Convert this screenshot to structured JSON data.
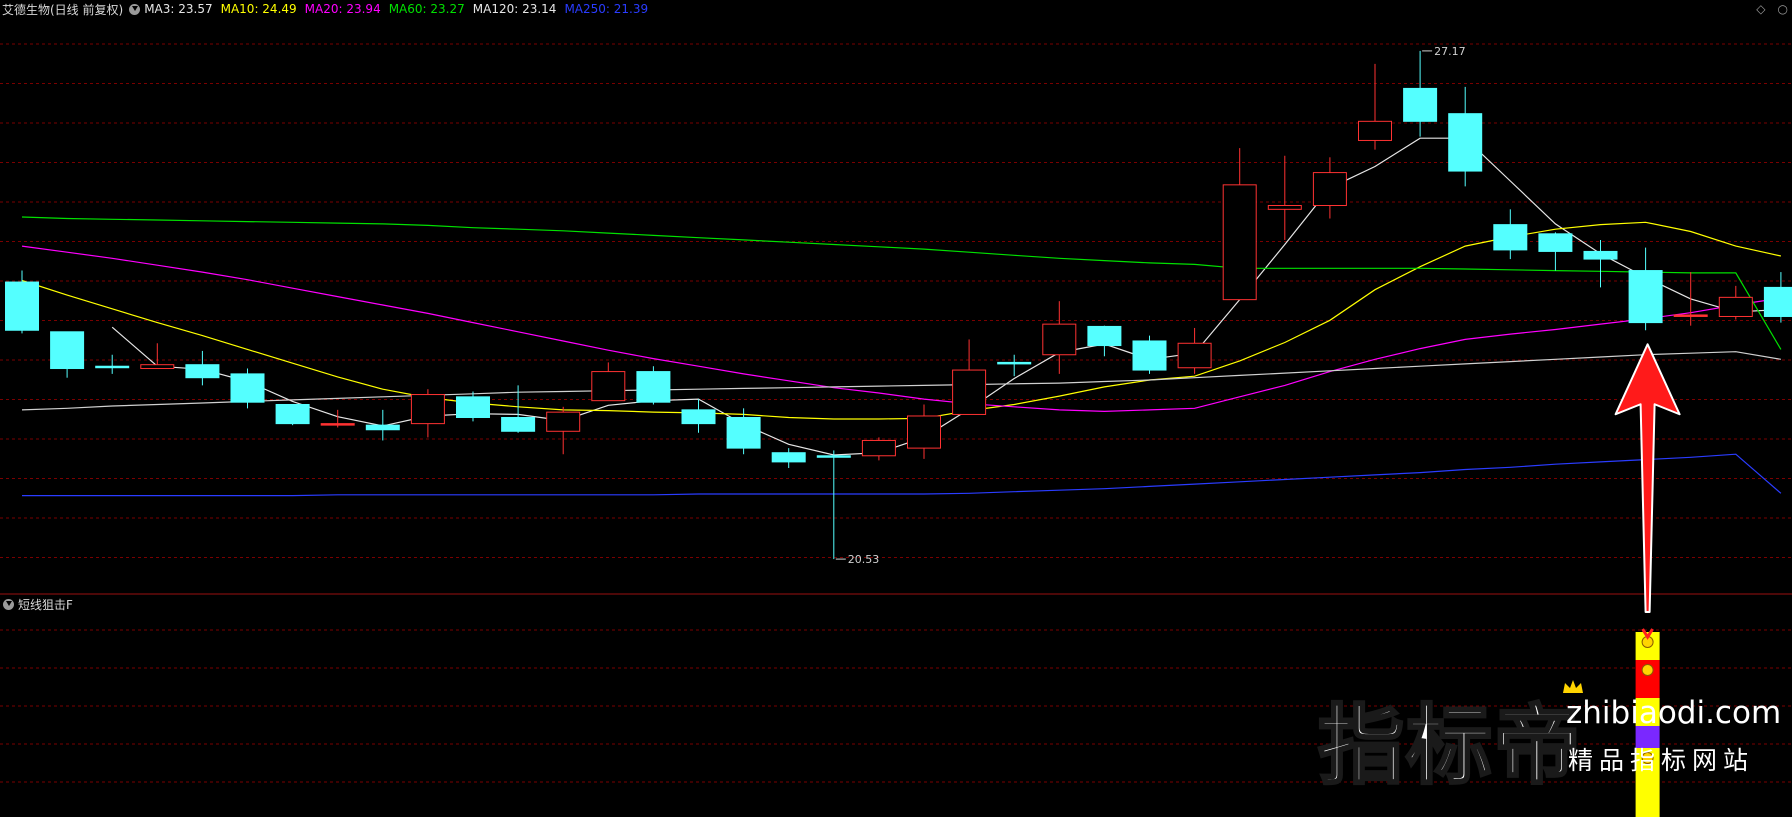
{
  "header": {
    "title": "艾德生物(日线 前复权)",
    "ma_items": [
      {
        "label": "MA3: 23.57",
        "color": "#e6e6e6"
      },
      {
        "label": "MA10: 24.49",
        "color": "#ffff00"
      },
      {
        "label": "MA20: 23.94",
        "color": "#ff00ff"
      },
      {
        "label": "MA60: 23.27",
        "color": "#00e000"
      },
      {
        "label": "MA120: 23.14",
        "color": "#e6e6e6"
      },
      {
        "label": "MA250: 21.39",
        "color": "#2a3cff"
      }
    ],
    "icons": [
      "diamond-icon",
      "close-icon"
    ]
  },
  "sub_panel": {
    "title": "短线狙击F"
  },
  "watermark": {
    "brand": "指标帝",
    "domain": "zhibiaodi.com",
    "tagline": "精品指标网站"
  },
  "colors": {
    "up": "#ff3232",
    "down": "#54ffff",
    "grid": "#7a0000",
    "ma3": "#e6e6e6",
    "ma10": "#ffff00",
    "ma20": "#ff00ff",
    "ma60": "#00e000",
    "ma120": "#d0d0d0",
    "ma250": "#2a3cff",
    "arrow": "#ff1a1a"
  },
  "chart_data": {
    "type": "candlestick",
    "title": "艾德生物(日线 前复权)",
    "xlabel": "",
    "ylabel": "",
    "ylim": [
      20.1,
      27.6
    ],
    "grid": true,
    "annotations": [
      {
        "text": "27.17",
        "value": 27.17,
        "candle_index": 31
      },
      {
        "text": "20.53",
        "value": 20.53,
        "candle_index": 18
      }
    ],
    "candles": [
      {
        "o": 24.15,
        "c": 23.52,
        "h": 24.3,
        "l": 23.48
      },
      {
        "o": 23.5,
        "c": 23.02,
        "h": 23.5,
        "l": 22.9
      },
      {
        "o": 23.05,
        "c": 23.05,
        "h": 23.2,
        "l": 22.95
      },
      {
        "o": 23.02,
        "c": 23.07,
        "h": 23.35,
        "l": 23.02
      },
      {
        "o": 23.07,
        "c": 22.9,
        "h": 23.25,
        "l": 22.8
      },
      {
        "o": 22.95,
        "c": 22.58,
        "h": 23.02,
        "l": 22.5
      },
      {
        "o": 22.55,
        "c": 22.3,
        "h": 22.55,
        "l": 22.28
      },
      {
        "o": 22.3,
        "c": 22.3,
        "h": 22.48,
        "l": 22.25
      },
      {
        "o": 22.28,
        "c": 22.22,
        "h": 22.48,
        "l": 22.08
      },
      {
        "o": 22.3,
        "c": 22.68,
        "h": 22.75,
        "l": 22.12
      },
      {
        "o": 22.65,
        "c": 22.38,
        "h": 22.72,
        "l": 22.33
      },
      {
        "o": 22.38,
        "c": 22.2,
        "h": 22.8,
        "l": 22.18
      },
      {
        "o": 22.2,
        "c": 22.45,
        "h": 22.52,
        "l": 21.9
      },
      {
        "o": 22.6,
        "c": 22.98,
        "h": 23.1,
        "l": 22.6
      },
      {
        "o": 22.98,
        "c": 22.58,
        "h": 23.05,
        "l": 22.55
      },
      {
        "o": 22.48,
        "c": 22.3,
        "h": 22.62,
        "l": 22.18
      },
      {
        "o": 22.38,
        "c": 21.98,
        "h": 22.5,
        "l": 21.9
      },
      {
        "o": 21.92,
        "c": 21.8,
        "h": 21.98,
        "l": 21.72
      },
      {
        "o": 21.88,
        "c": 21.88,
        "h": 21.95,
        "l": 20.53
      },
      {
        "o": 21.88,
        "c": 22.08,
        "h": 22.12,
        "l": 21.82
      },
      {
        "o": 21.98,
        "c": 22.4,
        "h": 22.55,
        "l": 21.84
      },
      {
        "o": 22.42,
        "c": 23.0,
        "h": 23.4,
        "l": 22.42
      },
      {
        "o": 23.1,
        "c": 23.1,
        "h": 23.2,
        "l": 22.92
      },
      {
        "o": 23.2,
        "c": 23.6,
        "h": 23.9,
        "l": 22.95
      },
      {
        "o": 23.57,
        "c": 23.32,
        "h": 23.58,
        "l": 23.18
      },
      {
        "o": 23.38,
        "c": 23.0,
        "h": 23.45,
        "l": 22.95
      },
      {
        "o": 23.03,
        "c": 23.35,
        "h": 23.55,
        "l": 22.95
      },
      {
        "o": 23.92,
        "c": 25.42,
        "h": 25.9,
        "l": 23.92
      },
      {
        "o": 25.1,
        "c": 25.15,
        "h": 25.8,
        "l": 24.7
      },
      {
        "o": 25.15,
        "c": 25.58,
        "h": 25.78,
        "l": 24.98
      },
      {
        "o": 26.0,
        "c": 26.25,
        "h": 27.0,
        "l": 25.88
      },
      {
        "o": 26.68,
        "c": 26.25,
        "h": 27.17,
        "l": 26.05
      },
      {
        "o": 26.35,
        "c": 25.6,
        "h": 26.7,
        "l": 25.4
      },
      {
        "o": 24.9,
        "c": 24.57,
        "h": 25.1,
        "l": 24.45
      },
      {
        "o": 24.78,
        "c": 24.55,
        "h": 24.8,
        "l": 24.3
      },
      {
        "o": 24.55,
        "c": 24.45,
        "h": 24.7,
        "l": 24.08
      },
      {
        "o": 24.3,
        "c": 23.62,
        "h": 24.6,
        "l": 23.52
      },
      {
        "o": 23.72,
        "c": 23.72,
        "h": 24.28,
        "l": 23.58
      },
      {
        "o": 23.7,
        "c": 23.95,
        "h": 24.1,
        "l": 23.66
      },
      {
        "o": 24.08,
        "c": 23.7,
        "h": 24.28,
        "l": 23.62
      }
    ],
    "series": [
      {
        "name": "MA3",
        "values": [
          null,
          null,
          23.56,
          23.05,
          23.01,
          22.85,
          22.59,
          22.39,
          22.27,
          22.4,
          22.43,
          22.42,
          22.34,
          22.54,
          22.6,
          22.62,
          22.29,
          22.03,
          21.89,
          21.92,
          22.12,
          22.49,
          22.89,
          23.23,
          23.34,
          23.14,
          23.22,
          23.92,
          24.64,
          25.38,
          25.66,
          26.03,
          26.03,
          25.47,
          24.91,
          24.52,
          24.21,
          23.93,
          23.76,
          23.79
        ]
      },
      {
        "name": "MA10",
        "values": [
          24.17,
          23.98,
          23.8,
          23.62,
          23.45,
          23.27,
          23.09,
          22.91,
          22.75,
          22.64,
          22.57,
          22.52,
          22.48,
          22.47,
          22.45,
          22.44,
          22.42,
          22.38,
          22.36,
          22.36,
          22.37,
          22.47,
          22.55,
          22.66,
          22.78,
          22.87,
          22.92,
          23.12,
          23.36,
          23.65,
          24.05,
          24.35,
          24.62,
          24.74,
          24.84,
          24.9,
          24.93,
          24.81,
          24.62,
          24.49
        ]
      },
      {
        "name": "MA20",
        "values": [
          24.62,
          24.54,
          24.46,
          24.37,
          24.28,
          24.18,
          24.07,
          23.96,
          23.85,
          23.74,
          23.62,
          23.5,
          23.38,
          23.26,
          23.15,
          23.05,
          22.95,
          22.86,
          22.77,
          22.7,
          22.62,
          22.56,
          22.52,
          22.48,
          22.46,
          22.48,
          22.5,
          22.65,
          22.8,
          22.98,
          23.14,
          23.28,
          23.4,
          23.47,
          23.53,
          23.6,
          23.67,
          23.75,
          23.85,
          23.94
        ]
      },
      {
        "name": "MA60",
        "values": [
          25.0,
          24.98,
          24.97,
          24.96,
          24.95,
          24.94,
          24.93,
          24.92,
          24.91,
          24.89,
          24.86,
          24.84,
          24.82,
          24.79,
          24.76,
          24.73,
          24.7,
          24.67,
          24.64,
          24.61,
          24.58,
          24.54,
          24.5,
          24.46,
          24.43,
          24.4,
          24.38,
          24.33,
          24.33,
          24.33,
          24.33,
          24.33,
          24.32,
          24.31,
          24.3,
          24.29,
          24.28,
          24.27,
          24.27,
          23.27
        ]
      },
      {
        "name": "MA120",
        "values": [
          22.48,
          22.5,
          22.53,
          22.55,
          22.57,
          22.59,
          22.61,
          22.63,
          22.65,
          22.67,
          22.69,
          22.71,
          22.72,
          22.73,
          22.74,
          22.75,
          22.76,
          22.77,
          22.78,
          22.79,
          22.8,
          22.81,
          22.82,
          22.83,
          22.85,
          22.87,
          22.9,
          22.93,
          22.96,
          22.99,
          23.02,
          23.05,
          23.08,
          23.11,
          23.14,
          23.17,
          23.2,
          23.22,
          23.24,
          23.14
        ]
      },
      {
        "name": "MA250",
        "values": [
          21.36,
          21.36,
          21.36,
          21.36,
          21.36,
          21.36,
          21.36,
          21.37,
          21.37,
          21.37,
          21.37,
          21.37,
          21.37,
          21.37,
          21.37,
          21.38,
          21.38,
          21.38,
          21.38,
          21.38,
          21.38,
          21.39,
          21.41,
          21.43,
          21.45,
          21.48,
          21.51,
          21.54,
          21.57,
          21.6,
          21.63,
          21.66,
          21.7,
          21.73,
          21.77,
          21.8,
          21.83,
          21.86,
          21.9,
          21.39
        ]
      }
    ],
    "signal": {
      "candle_index": 36,
      "segments": [
        {
          "color": "#ffff00",
          "marker": "medal"
        },
        {
          "color": "#ff0000",
          "marker": "moneybag"
        },
        {
          "color": "#ffff00",
          "marker": ""
        },
        {
          "color": "#7a28ff",
          "marker": ""
        },
        {
          "color": "#ffff00",
          "marker": "moneybag"
        }
      ]
    }
  }
}
